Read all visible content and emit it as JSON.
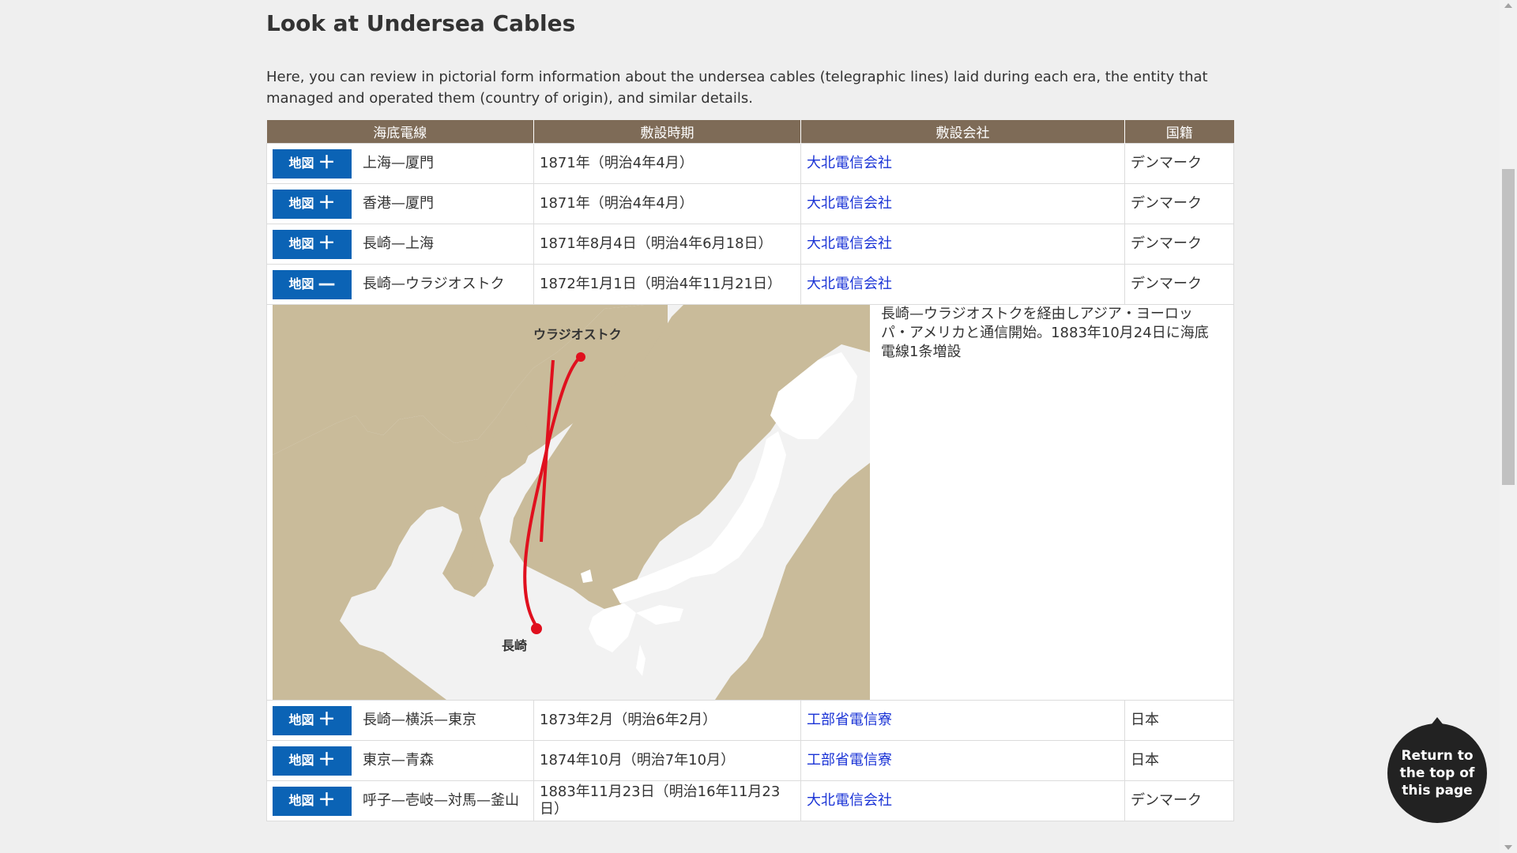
{
  "page": {
    "title": "Look at Undersea Cables",
    "intro": "Here, you can review in pictorial form information about the undersea cables (telegraphic lines) laid during each era, the entity that managed and operated them (country of origin), and similar details."
  },
  "table": {
    "headers": [
      "海底電線",
      "敷設時期",
      "敷設会社",
      "国籍"
    ],
    "rows": [
      {
        "map_label": "地図",
        "toggle": "＋",
        "cable": "上海—厦門",
        "period": "1871年（明治4年4月）",
        "company": "大北電信会社",
        "nationality": "デンマーク"
      },
      {
        "map_label": "地図",
        "toggle": "＋",
        "cable": "香港—厦門",
        "period": "1871年（明治4年4月）",
        "company": "大北電信会社",
        "nationality": "デンマーク"
      },
      {
        "map_label": "地図",
        "toggle": "＋",
        "cable": "長崎—上海",
        "period": "1871年8月4日（明治4年6月18日）",
        "company": "大北電信会社",
        "nationality": "デンマーク"
      },
      {
        "map_label": "地図",
        "toggle": "—",
        "cable": "長崎—ウラジオストク",
        "period": "1872年1月1日（明治4年11月21日）",
        "company": "大北電信会社",
        "nationality": "デンマーク"
      }
    ],
    "expanded_detail": {
      "map_labels": {
        "vladivostok": "ウラジオストク",
        "nagasaki": "長崎"
      },
      "text": "長崎—ウラジオストクを経由しアジア・ヨーロッパ・アメリカと通信開始。1883年10月24日に海底電線1条増設"
    },
    "rows_after": [
      {
        "map_label": "地図",
        "toggle": "＋",
        "cable": "長崎—横浜—東京",
        "period": "1873年2月（明治6年2月）",
        "company": "工部省電信寮",
        "nationality": "日本"
      },
      {
        "map_label": "地図",
        "toggle": "＋",
        "cable": "東京—青森",
        "period": "1874年10月（明治7年10月）",
        "company": "工部省電信寮",
        "nationality": "日本"
      },
      {
        "map_label": "地図",
        "toggle": "＋",
        "cable": "呼子—壱岐—対馬—釜山",
        "period": "1883年11月23日（明治16年11月23日）",
        "company": "大北電信会社",
        "nationality": "デンマーク"
      }
    ]
  },
  "colors": {
    "header_bg": "#7e6b57",
    "button_bg": "#0b63b5",
    "link": "#1a33d6",
    "cable_line": "#e0101e"
  },
  "back_to_top": {
    "label": "Return to the top of this page"
  }
}
